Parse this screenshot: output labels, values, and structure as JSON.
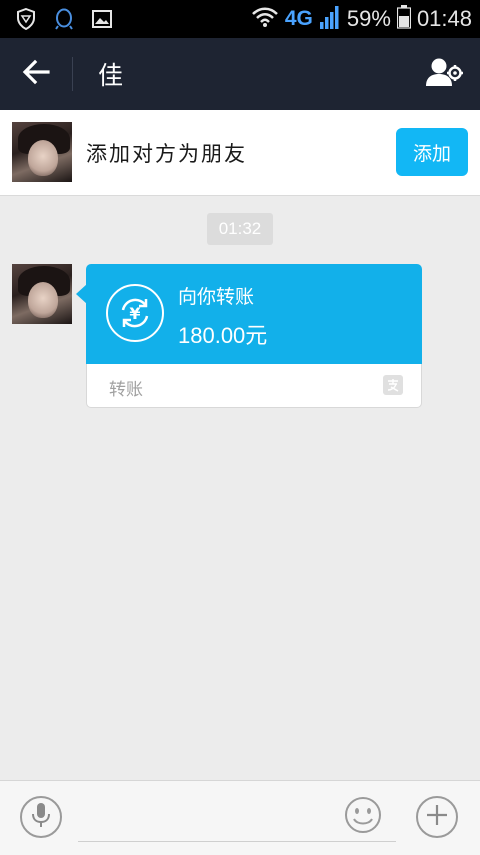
{
  "status_bar": {
    "network": "4G",
    "battery_percent": "59%",
    "time": "01:48",
    "icons": [
      "shield-icon",
      "qq-icon",
      "image-icon",
      "wifi-icon",
      "signal-icon",
      "battery-icon"
    ]
  },
  "header": {
    "title": "佳",
    "back_icon": "arrow-left-icon",
    "profile_icon": "user-settings-icon"
  },
  "add_friend": {
    "text": "添加对方为朋友",
    "button_label": "添加"
  },
  "chat": {
    "timestamp": "01:32",
    "transfer": {
      "title": "向你转账",
      "amount": "180.00元",
      "footer_label": "转账",
      "icon": "yuan-refresh-icon",
      "footer_icon": "alipay-icon"
    }
  },
  "input": {
    "placeholder": "",
    "mic_icon": "microphone-icon",
    "emoji_icon": "smiley-icon",
    "plus_icon": "plus-icon"
  },
  "colors": {
    "status_bar": "#000000",
    "header": "#1e2432",
    "accent": "#12b7f5",
    "card": "#12b0ea",
    "background": "#ececec"
  }
}
